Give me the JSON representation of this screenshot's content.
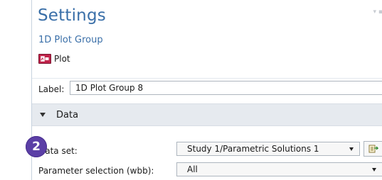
{
  "settings": {
    "title": "Settings",
    "subtitle": "1D Plot Group",
    "plot_label": "Plot"
  },
  "label_field": {
    "label": "Label:",
    "value": "1D Plot Group 8"
  },
  "data_section": {
    "title": "Data",
    "dataset": {
      "label": "Data set:",
      "value": "Study 1/Parametric Solutions 1"
    },
    "parameter_selection": {
      "label": "Parameter selection (wbb):",
      "value": "All"
    }
  },
  "callout": {
    "number": "2",
    "color": "#5b3fa6"
  },
  "icons": [
    "plot-icon",
    "pin-icon",
    "chevron-down-icon",
    "dataset-goto-icon"
  ],
  "colors": {
    "accent": "#3a6fa8",
    "section_bg": "#e6eaef"
  }
}
